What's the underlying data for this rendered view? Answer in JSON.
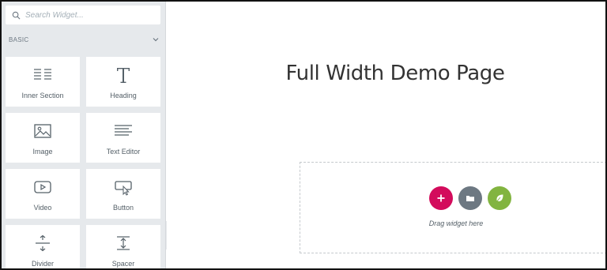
{
  "panel": {
    "search": {
      "placeholder": "Search Widget..."
    },
    "section": {
      "title": "BASIC",
      "icon": "chevron-down-icon"
    },
    "widgets": [
      {
        "label": "Inner Section",
        "icon": "inner-section-icon"
      },
      {
        "label": "Heading",
        "icon": "heading-icon"
      },
      {
        "label": "Image",
        "icon": "image-icon"
      },
      {
        "label": "Text Editor",
        "icon": "text-editor-icon"
      },
      {
        "label": "Video",
        "icon": "video-icon"
      },
      {
        "label": "Button",
        "icon": "button-icon"
      },
      {
        "label": "Divider",
        "icon": "divider-icon"
      },
      {
        "label": "Spacer",
        "icon": "spacer-icon"
      }
    ]
  },
  "canvas": {
    "page_title": "Full Width Demo Page",
    "drop_zone": {
      "hint": "Drag widget here",
      "buttons": [
        {
          "name": "add-section",
          "icon": "plus-icon",
          "color": "#d30c5c"
        },
        {
          "name": "add-template",
          "icon": "folder-icon",
          "color": "#6d7882"
        },
        {
          "name": "template-kit",
          "icon": "leaf-icon",
          "color": "#82b440"
        }
      ]
    }
  },
  "colors": {
    "panel_bg": "#e6e9ec",
    "accent_pink": "#d30c5c",
    "icon_gray": "#556068"
  }
}
